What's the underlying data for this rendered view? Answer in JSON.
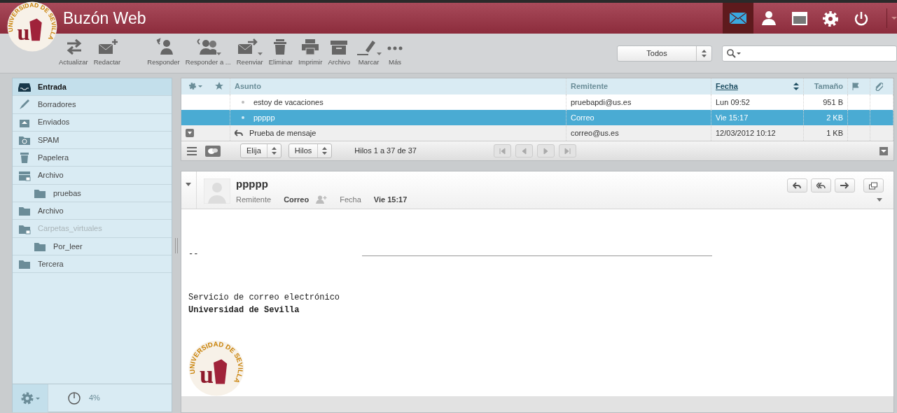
{
  "header": {
    "title": "Buzón Web",
    "logo_text": "UNIVERSIDAD DE SEVILLA",
    "logo_letter": "u",
    "apps": [
      {
        "kind": "mail",
        "selected": true
      },
      {
        "kind": "contacts",
        "selected": false
      },
      {
        "kind": "calendar",
        "selected": false
      },
      {
        "kind": "settings",
        "selected": false
      },
      {
        "kind": "logout",
        "selected": false
      }
    ]
  },
  "toolbar": {
    "buttons": [
      {
        "kind": "refresh",
        "label": "Actualizar",
        "dropdown": false
      },
      {
        "kind": "compose",
        "label": "Redactar",
        "dropdown": false
      },
      {
        "kind": "reply",
        "label": "Responder",
        "dropdown": false
      },
      {
        "kind": "replyall",
        "label": "Responder a ...",
        "dropdown": true
      },
      {
        "kind": "forward",
        "label": "Reenviar",
        "dropdown": true
      },
      {
        "kind": "delete",
        "label": "Eliminar",
        "dropdown": false
      },
      {
        "kind": "print",
        "label": "Imprimir",
        "dropdown": false
      },
      {
        "kind": "archive",
        "label": "Archivo",
        "dropdown": false
      },
      {
        "kind": "mark",
        "label": "Marcar",
        "dropdown": true
      },
      {
        "kind": "more",
        "label": "Más",
        "dropdown": false
      }
    ],
    "filter": "Todos"
  },
  "sidebar": {
    "folders": [
      {
        "kind": "inbox",
        "label": "Entrada",
        "selected": true,
        "disabled": false
      },
      {
        "kind": "drafts",
        "label": "Borradores",
        "selected": false,
        "disabled": false
      },
      {
        "kind": "sent",
        "label": "Enviados",
        "selected": false,
        "disabled": false
      },
      {
        "kind": "spam",
        "label": "SPAM",
        "selected": false,
        "disabled": false
      },
      {
        "kind": "trash",
        "label": "Papelera",
        "selected": false,
        "disabled": false
      },
      {
        "kind": "archive",
        "label": "Archivo",
        "selected": false,
        "disabled": false,
        "children": [
          {
            "kind": "folder",
            "label": "pruebas",
            "selected": false,
            "disabled": false
          }
        ]
      },
      {
        "kind": "folder",
        "label": "Archivo",
        "selected": false,
        "disabled": false
      },
      {
        "kind": "virtual",
        "label": "Carpetas_virtuales",
        "selected": false,
        "disabled": true,
        "children": [
          {
            "kind": "folder",
            "label": "Por_leer",
            "selected": false,
            "disabled": false
          }
        ]
      },
      {
        "kind": "folder",
        "label": "Tercera",
        "selected": false,
        "disabled": false
      }
    ],
    "quota": "4%"
  },
  "message_list": {
    "columns": [
      {
        "kind": "subject",
        "label": "Asunto",
        "sorted": false
      },
      {
        "kind": "from",
        "label": "Remitente",
        "sorted": false
      },
      {
        "kind": "date",
        "label": "Fecha",
        "sorted": true
      },
      {
        "kind": "size",
        "label": "Tamaño",
        "sorted": false
      }
    ],
    "rows": [
      {
        "unread": true,
        "replied": false,
        "subject": "estoy de vacaciones",
        "from": "pruebapdi@us.es",
        "date": "Lun 09:52",
        "size": "951 B",
        "selected": false,
        "thread": false
      },
      {
        "unread": true,
        "replied": false,
        "subject": "ppppp",
        "from": "Correo",
        "date": "Vie 15:17",
        "size": "2 KB",
        "selected": true,
        "thread": false
      },
      {
        "unread": false,
        "replied": true,
        "subject": "Prueba de mensaje",
        "from": "correo@us.es",
        "date": "12/03/2012 10:12",
        "size": "1 KB",
        "selected": false,
        "thread": true
      }
    ],
    "select_menu": "Elija",
    "threads_menu": "Hilos",
    "count": "Hilos 1 a 37 de 37"
  },
  "preview": {
    "logo_text": "UNIVERSIDAD DE SEVILLA",
    "logo_letter": "u",
    "subject": "ppppp",
    "from_label": "Remitente",
    "from": "Correo",
    "date_label": "Fecha",
    "date": "Vie 15:17",
    "body": [
      {
        "kind": "dash",
        "text": "--"
      },
      {
        "kind": "line",
        "text": "Servicio de correo electrónico"
      },
      {
        "kind": "bold",
        "text": "Universidad de Sevilla"
      }
    ]
  }
}
